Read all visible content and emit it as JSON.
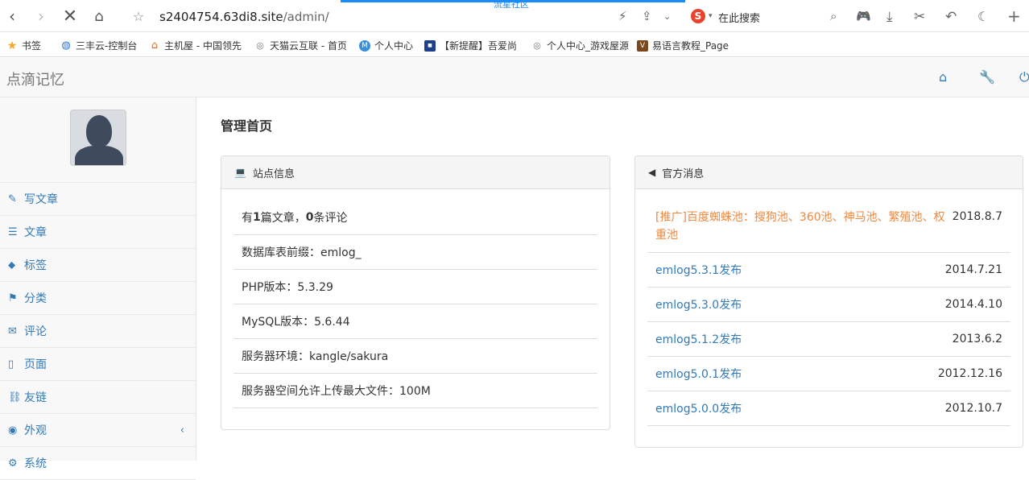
{
  "browser": {
    "overlay_text": "流星社区",
    "url_host": "s2404754.63di8.site",
    "url_path": "/admin/",
    "search_placeholder": "在此搜索"
  },
  "bookmarks": [
    {
      "label": "书签",
      "icon": "star-icon"
    },
    {
      "label": "三丰云-控制台",
      "icon": "globe-icon"
    },
    {
      "label": "主机屋 - 中国领先",
      "icon": "house-icon"
    },
    {
      "label": "天猫云互联 - 首页",
      "icon": "globe-icon"
    },
    {
      "label": "个人中心",
      "icon": "m-logo-icon"
    },
    {
      "label": "【新提醒】吾爱尚",
      "icon": "site-logo-icon"
    },
    {
      "label": "个人中心_游戏屋源",
      "icon": "globe-icon"
    },
    {
      "label": "易语言教程_Page",
      "icon": "v-logo-icon"
    }
  ],
  "header": {
    "brand": "点滴记忆"
  },
  "sidebar": {
    "items": [
      {
        "label": "写文章",
        "icon": "edit-icon",
        "glyph": "✎"
      },
      {
        "label": "文章",
        "icon": "list-icon",
        "glyph": "☰"
      },
      {
        "label": "标签",
        "icon": "tags-icon",
        "glyph": "⬥"
      },
      {
        "label": "分类",
        "icon": "flag-icon",
        "glyph": "⚑"
      },
      {
        "label": "评论",
        "icon": "comments-icon",
        "glyph": "✉"
      },
      {
        "label": "页面",
        "icon": "file-icon",
        "glyph": "▯"
      },
      {
        "label": "友链",
        "icon": "link-icon",
        "glyph": "⛓"
      },
      {
        "label": "外观",
        "icon": "eye-icon",
        "glyph": "◉",
        "expandable": true
      },
      {
        "label": "系统",
        "icon": "gear-icon",
        "glyph": "⚙"
      }
    ]
  },
  "main": {
    "title": "管理首页",
    "site_info": {
      "heading": "站点信息",
      "articles_prefix": "有",
      "articles_count": "1",
      "articles_mid": "篇文章，",
      "comments_count": "0",
      "comments_suffix": "条评论",
      "rows": [
        "数据库表前缀：emlog_",
        "PHP版本：5.3.29",
        "MySQL版本：5.6.44",
        "服务器环境：kangle/sakura",
        "服务器空间允许上传最大文件：100M"
      ]
    },
    "news": {
      "heading": "官方消息",
      "items": [
        {
          "title": "[推广]百度蜘蛛池：搜狗池、360池、神马池、繁殖池、权重池",
          "date": "2018.8.7",
          "promo": true
        },
        {
          "title": "emlog5.3.1发布",
          "date": "2014.7.21"
        },
        {
          "title": "emlog5.3.0发布",
          "date": "2014.4.10"
        },
        {
          "title": "emlog5.1.2发布",
          "date": "2013.6.2"
        },
        {
          "title": "emlog5.0.1发布",
          "date": "2012.12.16"
        },
        {
          "title": "emlog5.0.0发布",
          "date": "2012.10.7"
        }
      ]
    }
  },
  "colors": {
    "link": "#337ab7",
    "promo": "#f0883c",
    "progress": "#1a8cff"
  }
}
